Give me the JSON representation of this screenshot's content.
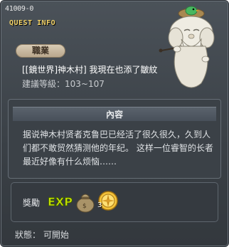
{
  "window": {
    "quest_id": "41009-0",
    "section_title": "QUEST INFO"
  },
  "quest": {
    "job_tab": "職業",
    "title": "[[鏡世界]神木村] 我現在也添了皺紋",
    "level": "建議等級：103~107"
  },
  "content": {
    "header": "內容",
    "text": "据说神木村贤者克鲁巴已经活了很久很久，久到人们都不敢贸然猜测他的年纪。 这样一位睿智的长者最近好像有什么烦恼……"
  },
  "reward": {
    "label": "獎勵",
    "items": [
      {
        "icon": "exp-icon",
        "label": "EXP"
      },
      {
        "icon": "money-bag-icon"
      },
      {
        "icon": "compass-coin-icon",
        "count": "3"
      }
    ]
  },
  "status": {
    "text": "狀態：  可開始"
  },
  "colors": {
    "title_yellow": "#f2d36a",
    "panel": "#3b4147",
    "exp_yellow": "#c6e000"
  }
}
